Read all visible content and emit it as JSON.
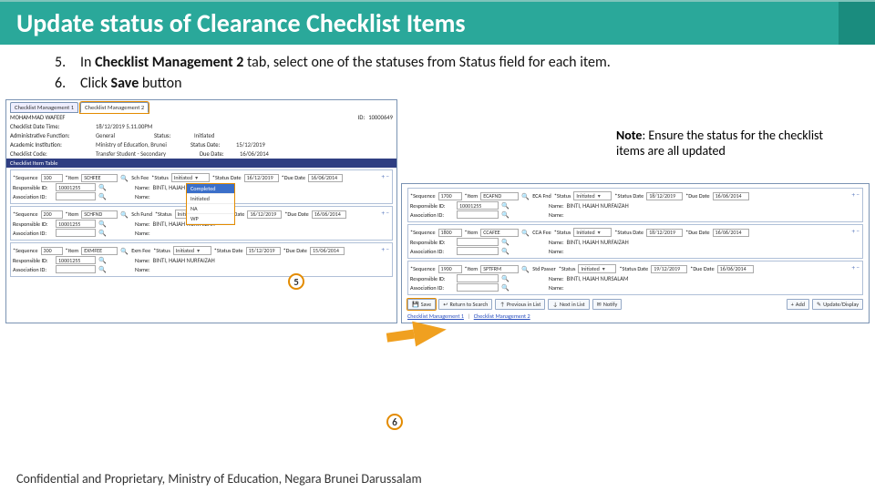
{
  "title": "Update status of Clearance Checklist Items",
  "instructions": [
    {
      "num": "5.",
      "text_a": "In ",
      "bold_a": "Checklist Management 2",
      "text_b": " tab, select one of the statuses from Status field for each item."
    },
    {
      "num": "6.",
      "text_a": "Click ",
      "bold_a": "Save",
      "text_b": " button"
    }
  ],
  "note": {
    "label": "Note",
    "text": ": Ensure the status for the checklist items are all updated"
  },
  "left": {
    "tab1": "Checklist Management 1",
    "tab2": "Checklist Management 2",
    "name": "MOHAMMAD WAFEEF",
    "id_label": "ID:",
    "id": "10000649",
    "fields": {
      "dt_label": "Checklist Date Time:",
      "dt": "18/12/2019  5.11.00PM",
      "af_label": "Administrative Function:",
      "af": "General",
      "status_label": "Status:",
      "status": "Initiated",
      "ai_label": "Academic Institution:",
      "ai": "Ministry of Education, Brunei",
      "sd_label": "Status Date:",
      "sd": "15/12/2019",
      "cc_label": "Checklist Code:",
      "cc": "Transfer Student - Secondary",
      "dd_label": "Due Date:",
      "dd": "16/06/2014"
    },
    "table_title": "Checklist Item Table",
    "cols": {
      "seq": "Sequence",
      "item": "Item",
      "status": "Status",
      "sdate": "Status Date",
      "ddate": "Due Date"
    },
    "sub": {
      "resp": "Responsible ID:",
      "name": "Name:",
      "assoc": "Association ID:"
    },
    "items": [
      {
        "seq": "100",
        "item_code": "SCHFEE",
        "item_desc": "Sch Fee",
        "status": "Initiated",
        "sdate": "16/12/2019",
        "ddate": "16/06/2014",
        "resp": "10001255",
        "name": "BINTI, HAJAH NURFAIZAH"
      },
      {
        "seq": "200",
        "item_code": "SCHFND",
        "item_desc": "Sch Fund",
        "status": "Initiated",
        "sdate": "16/12/2019",
        "ddate": "16/06/2014",
        "resp": "10001255",
        "name": "BINTI, HAJAH NURFAIZAH"
      },
      {
        "seq": "300",
        "item_code": "EXMFEE",
        "item_desc": "Exm Fee",
        "status": "Initiated",
        "sdate": "15/12/2019",
        "ddate": "15/06/2014",
        "resp": "10001255",
        "name": "BINTI, HAJAH NURFAIZAH"
      }
    ],
    "dropdown": [
      "Completed",
      "Initiated",
      "NA",
      "WP"
    ]
  },
  "right": {
    "items": [
      {
        "seq": "1700",
        "item_code": "ECAFND",
        "item_desc": "ECA Fnd",
        "status": "Initiated",
        "sdate": "18/12/2019",
        "ddate": "16/06/2014",
        "resp": "10001255",
        "name": "BINTI, HAJAH NURFAIZAH"
      },
      {
        "seq": "1800",
        "item_code": "CCAFEE",
        "item_desc": "CCA Fee",
        "status": "Initiated",
        "sdate": "18/12/2019",
        "ddate": "16/06/2014",
        "resp": "",
        "name": "BINTI, HAJAH NURFAIZAH"
      },
      {
        "seq": "1900",
        "item_code": "SPTFRM",
        "item_desc": "Std Passer",
        "status": "Initiated",
        "sdate": "19/12/2019",
        "ddate": "16/06/2014",
        "resp": "",
        "name": "BINTI, HAJAH NURSALAM"
      }
    ],
    "buttons": {
      "save": "Save",
      "return": "Return to Search",
      "prev": "Previous in List",
      "next": "Next in List",
      "notify": "Notify",
      "add": "Add",
      "update": "Update/Display"
    },
    "bottom_links": {
      "l1": "Checklist Management 1",
      "l2": "Checklist Management 2"
    }
  },
  "callouts": {
    "five": "5",
    "six": "6"
  },
  "footer": "Confidential and Proprietary, Ministry of Education, Negara Brunei Darussalam"
}
